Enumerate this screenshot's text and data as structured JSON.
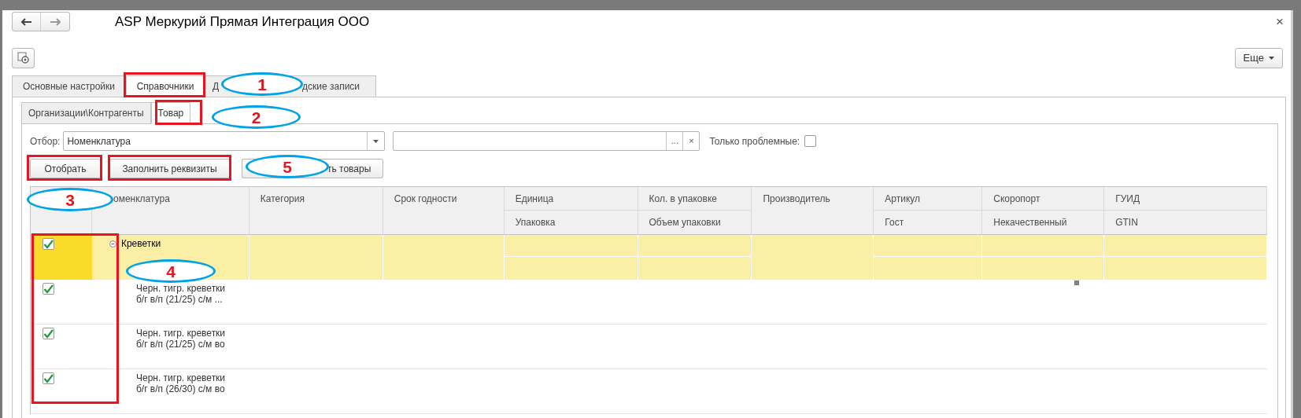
{
  "window": {
    "title": "ASP Меркурий Прямая Интеграция ООО",
    "close": "×"
  },
  "more_button": {
    "label": "Еще"
  },
  "tabs": [
    {
      "label": "Основные настройки",
      "selected": false
    },
    {
      "label": "Справочники",
      "selected": true
    },
    {
      "label": "Д",
      "label_end": "дские записи",
      "selected": false
    }
  ],
  "subtabs": [
    {
      "label": "Организации\\Контрагенты",
      "selected": false
    },
    {
      "label": "Товар",
      "selected": true
    }
  ],
  "filter": {
    "label": "Отбор:",
    "value": "Номенклатура",
    "search_buttons": [
      "...",
      "×"
    ],
    "only_problems": {
      "label": "Только проблемные:",
      "checked": false
    }
  },
  "buttons": [
    {
      "label": "Отобрать"
    },
    {
      "label": "Заполнить реквизиты"
    },
    {
      "label": "ть товары"
    }
  ],
  "table": {
    "columns": [
      {
        "label": "оменклатура"
      },
      {
        "label": "Категория"
      },
      {
        "label": "Срок годности"
      },
      {
        "label": "Единица",
        "sublabel": "Упаковка"
      },
      {
        "label": "Кол. в упаковке",
        "sublabel": "Объем упаковки"
      },
      {
        "label": "Производитель"
      },
      {
        "label": "Артикул",
        "sublabel": "Гост"
      },
      {
        "label": "Скоропорт",
        "sublabel": "Некачественный"
      },
      {
        "label": "ГУИД",
        "sublabel": "GTIN"
      }
    ],
    "rows": [
      {
        "kind": "group",
        "checked": true,
        "expanded": true,
        "selected": true,
        "name": [
          "Креветки"
        ]
      },
      {
        "kind": "item",
        "checked": true,
        "selected": false,
        "name": [
          "Черн. тигр. креветки",
          "б/г в/п (21/25) с/м ..."
        ]
      },
      {
        "kind": "item",
        "checked": true,
        "selected": false,
        "name": [
          "Черн. тигр. креветки",
          "б/г в/п (21/25) с/м во"
        ]
      },
      {
        "kind": "item",
        "checked": true,
        "selected": false,
        "name": [
          "Черн. тигр. креветки",
          "б/г в/п (26/30) с/м во"
        ]
      }
    ]
  },
  "annotations": [
    {
      "kind": "box"
    },
    {
      "kind": "box"
    },
    {
      "kind": "box"
    },
    {
      "kind": "box"
    },
    {
      "kind": "box"
    },
    {
      "kind": "ellipse",
      "label": "1"
    },
    {
      "kind": "ellipse",
      "label": "2"
    },
    {
      "kind": "ellipse",
      "label": "5"
    },
    {
      "kind": "ellipse",
      "label": "3"
    },
    {
      "kind": "ellipse",
      "label": "4"
    }
  ]
}
